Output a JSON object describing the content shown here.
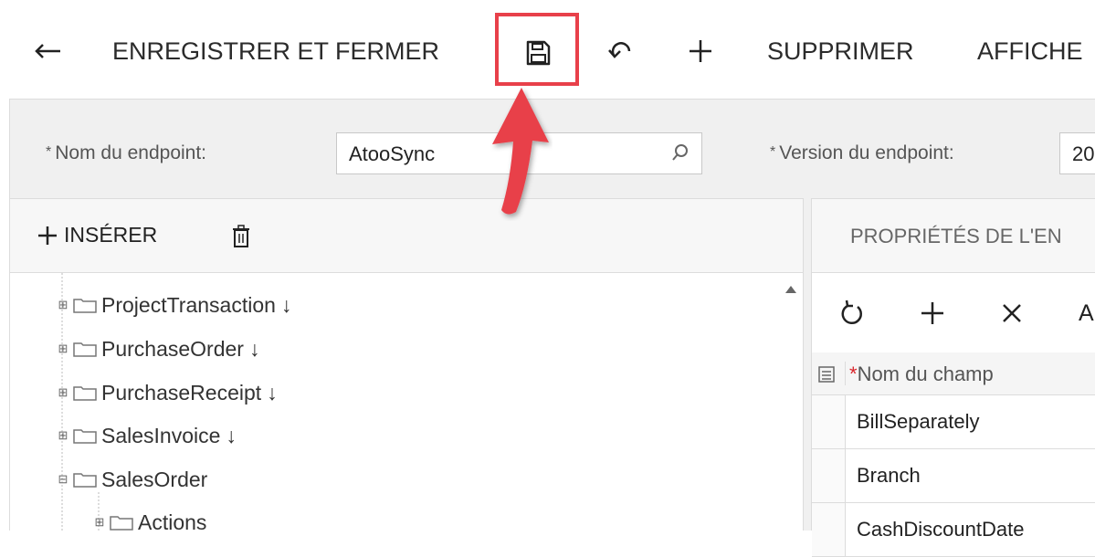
{
  "toolbar": {
    "back_icon": "arrow-left-icon",
    "save_close_label": "ENREGISTRER ET FERMER",
    "save_icon": "floppy-disk-icon",
    "undo_icon": "undo-icon",
    "add_icon": "plus-icon",
    "delete_label": "SUPPRIMER",
    "show_label": "AFFICHE",
    "highlight_color": "#e8404a"
  },
  "form": {
    "endpoint_name_label": "Nom du endpoint:",
    "endpoint_name_value": "AtooSync",
    "endpoint_version_label": "Version du endpoint:",
    "endpoint_version_value": "20",
    "required_mark": "*"
  },
  "tree_panel": {
    "insert_label": "INSÉRER",
    "items": [
      {
        "label": "ProjectTransaction",
        "marker": "↓",
        "expander": "⊞"
      },
      {
        "label": "PurchaseOrder",
        "marker": "↓",
        "expander": "⊞"
      },
      {
        "label": "PurchaseReceipt",
        "marker": "↓",
        "expander": "⊞"
      },
      {
        "label": "SalesInvoice",
        "marker": "↓",
        "expander": "⊞"
      },
      {
        "label": "SalesOrder",
        "marker": "",
        "expander": "⊟"
      },
      {
        "label": "Actions",
        "marker": "",
        "expander": "⊞"
      }
    ]
  },
  "properties_panel": {
    "tab_title": "PROPRIÉTÉS DE L'EN",
    "tool_partial": "A",
    "column_header": "Nom du champ",
    "required_mark": "*",
    "rows": [
      "BillSeparately",
      "Branch",
      "CashDiscountDate"
    ]
  },
  "annotation": {
    "arrow_color": "#e8404a"
  }
}
